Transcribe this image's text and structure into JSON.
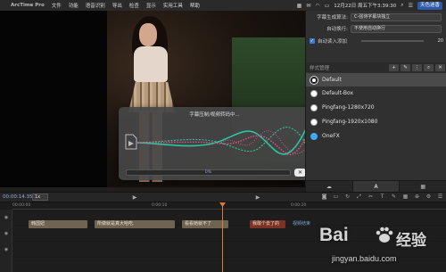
{
  "menubar": {
    "apple": "",
    "app_name": "ArcTime Pro",
    "items": [
      "文件",
      "功能",
      "语音识别",
      "导出",
      "检查",
      "显示",
      "实用工具",
      "帮助"
    ],
    "clock": "12月22日 周五下午3:39:30",
    "weather": "天色迷香"
  },
  "settings": {
    "row1_label": "字幕生成算法:",
    "row1_value": "C-强待字幕块独立",
    "row2_label": "自动换行:",
    "row2_value": "不使用自动换行",
    "auto_label": "自动读入添加",
    "auto_value": "20"
  },
  "style_panel": {
    "header": "样式管理",
    "toolbar": [
      "+",
      "✎",
      "⋮",
      "⌕",
      "✕"
    ],
    "styles": [
      {
        "name": "Default",
        "selected": true,
        "color": "#ffffff"
      },
      {
        "name": "Default-Box",
        "selected": false,
        "color": "#ffffff"
      },
      {
        "name": "Pingfang-1280x720",
        "selected": false,
        "color": "#ffffff"
      },
      {
        "name": "Pingfang-1920x1080",
        "selected": false,
        "color": "#ffffff"
      },
      {
        "name": "OneFX",
        "selected": false,
        "color": "#3fa9f5"
      }
    ],
    "tabs": [
      "☁",
      "A",
      "▦"
    ]
  },
  "dialog": {
    "title": "字幕压制/视频转码中...",
    "progress_label": "0%",
    "progress": 0.0,
    "close_label": "✕"
  },
  "toolbar": {
    "timecode": "00:00:14.350",
    "speed": "1x"
  },
  "timeline": {
    "ruler": [
      "00:00:00",
      "0:00:10",
      "0:00:20"
    ],
    "clips": [
      {
        "text": "韩国妞",
        "color": "#6f6351"
      },
      {
        "text": "所做就是真大哈吃.",
        "color": "#6f6351"
      },
      {
        "text": "看看她就不了",
        "color": "#6f6351"
      },
      {
        "text": "我敢个去了的",
        "color": "#7a3326"
      }
    ],
    "end_label": "视频结束"
  },
  "watermark": {
    "brand": "Bai",
    "brand2": "经验",
    "url": "jingyan.baidu.com"
  },
  "colors": {
    "accent": "#3a7bd5",
    "playhead": "#e07a2a",
    "wave_teal": "#2ec4a0",
    "wave_pink": "#e0508a"
  }
}
